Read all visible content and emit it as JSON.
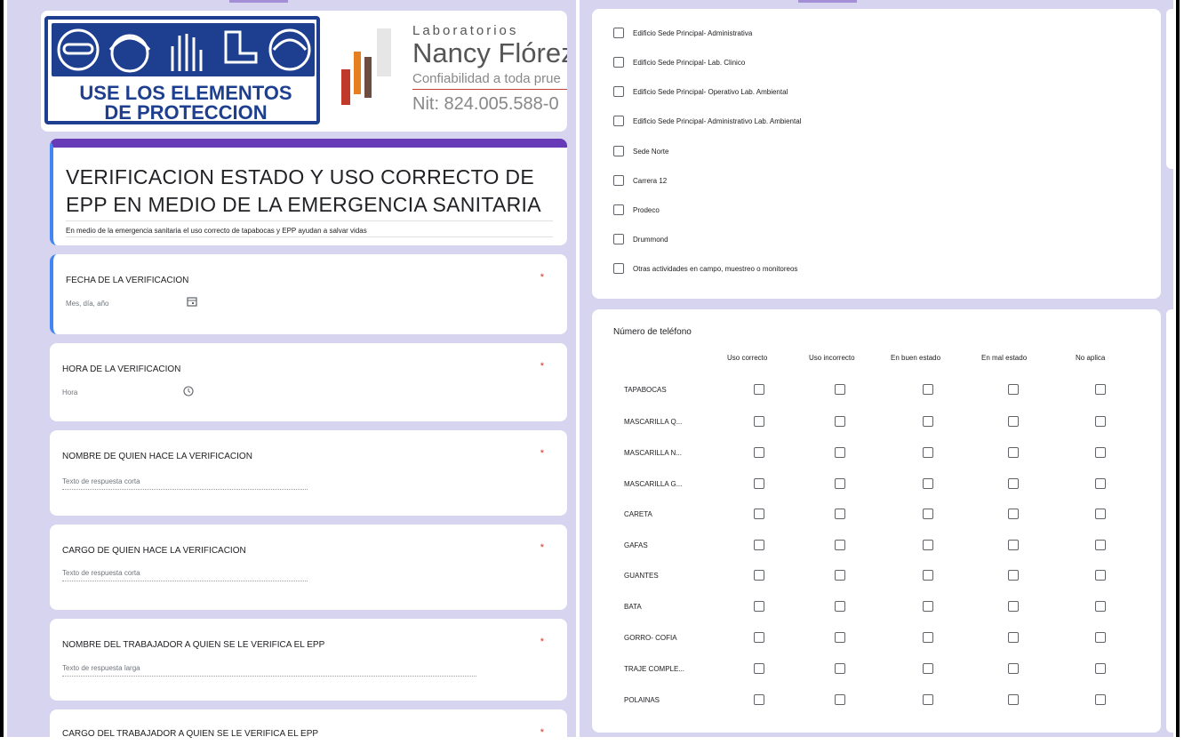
{
  "banner": {
    "sign_line1": "USE LOS ELEMENTOS",
    "sign_line2": "DE PROTECCION",
    "lab_small": "Laboratorios",
    "lab_name": "Nancy Flórez",
    "lab_tagline": "Confiabilidad a toda prue",
    "lab_nit": "Nit: 824.005.588-0",
    "sign_color": "#1e3f8f"
  },
  "form": {
    "title": "VERIFICACION ESTADO Y USO CORRECTO DE EPP EN MEDIO DE LA EMERGENCIA SANITARIA",
    "description": "En medio de la emergencia sanitaria el uso correcto de tapabocas y EPP ayudan a salvar vidas",
    "accent": "#673ab7"
  },
  "questions": [
    {
      "label": "FECHA DE LA VERIFICACION",
      "required": "*",
      "hint": "Mes, día, año",
      "icon": "calendar-icon"
    },
    {
      "label": "HORA DE LA VERIFICACION",
      "required": "*",
      "hint": "Hora",
      "icon": "clock-icon"
    },
    {
      "label": "NOMBRE DE QUIEN HACE LA VERIFICACION",
      "required": "*",
      "hint": "Texto de respuesta corta"
    },
    {
      "label": "CARGO DE QUIEN HACE LA VERIFICACION",
      "required": "*",
      "hint": "Texto de respuesta corta"
    },
    {
      "label": "NOMBRE DEL TRABAJADOR A QUIEN SE LE VERIFICA EL EPP",
      "required": "*",
      "hint": "Texto de respuesta larga"
    },
    {
      "label": "CARGO DEL TRABAJADOR A QUIEN SE LE VERIFICA EL EPP",
      "required": "*"
    }
  ],
  "locations": [
    "Edificio Sede Principal- Administrativa",
    "Edificio Sede Principal- Lab. Clinico",
    "Edificio Sede Principal- Operativo Lab. Ambiental",
    "Edificio Sede Principal- Administrativo Lab. Ambiental",
    "Sede Norte",
    "Carrera 12",
    "Prodeco",
    "Drummond",
    "Otras actividades en campo, muestreo o monitoreos"
  ],
  "grid": {
    "title": "Número de teléfono",
    "columns": [
      "Uso correcto",
      "Uso incorrecto",
      "En buen estado",
      "En mal estado",
      "No aplica"
    ],
    "rows": [
      "TAPABOCAS",
      "MASCARILLA Q...",
      "MASCARILLA N...",
      "MASCARILLA G...",
      "CARETA",
      "GAFAS",
      "GUANTES",
      "BATA",
      "GORRO- COFIA",
      "TRAJE COMPLE...",
      "POLAINAS"
    ]
  }
}
